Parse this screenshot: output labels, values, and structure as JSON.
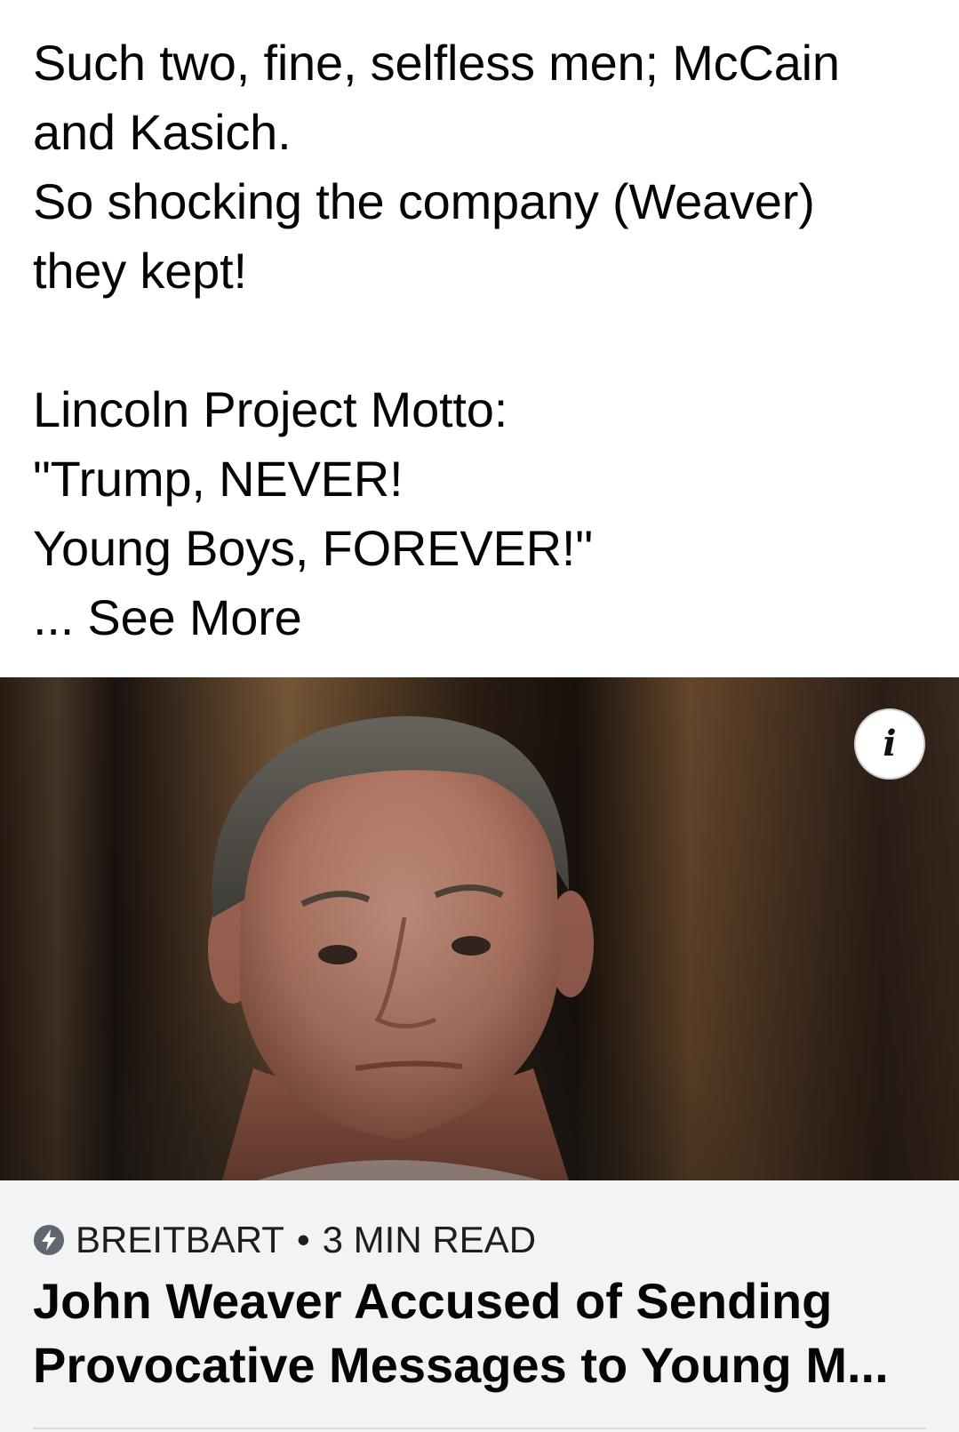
{
  "post": {
    "lines": [
      "Such two, fine, selfless men; McCain",
      "and Kasich.",
      "So shocking the company (Weaver)",
      "they kept!",
      "",
      "Lincoln Project Motto:",
      "\"Trump, NEVER!",
      "Young Boys, FOREVER!\""
    ],
    "see_more": "... See More"
  },
  "media": {
    "info_icon": "info-icon",
    "info_glyph": "i"
  },
  "link_card": {
    "source_icon": "bolt-icon",
    "source": "BREITBART",
    "separator": "•",
    "read_time": "3 MIN READ",
    "headline_lines": [
      "John Weaver Accused of Sending",
      "Provocative Messages to Young M..."
    ]
  },
  "colors": {
    "text": "#050505",
    "card_background": "#f2f3f5",
    "source_text": "#1c1e21"
  }
}
